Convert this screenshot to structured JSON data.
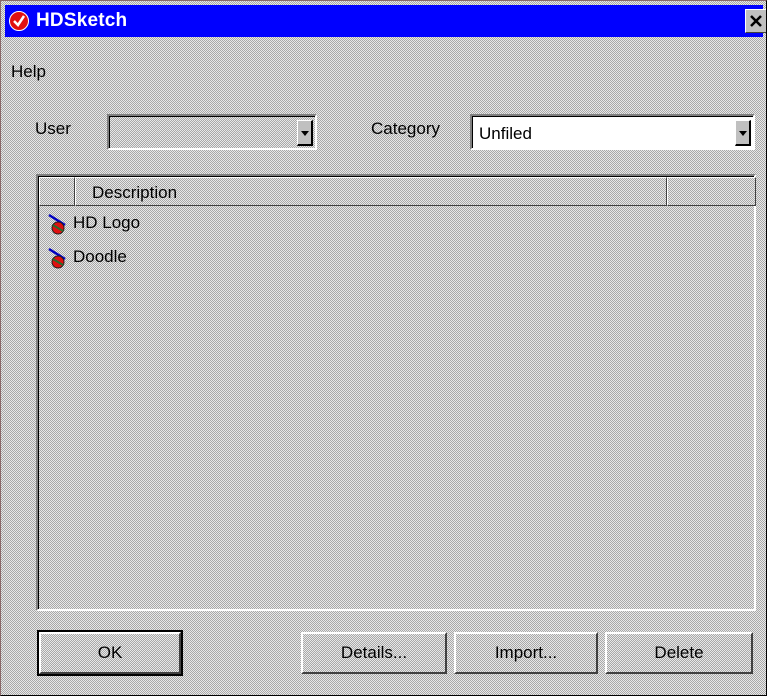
{
  "window": {
    "title": "HDSketch",
    "icon": "hdsketch-app-icon",
    "close_label": "×"
  },
  "menu": {
    "items": [
      "Help"
    ]
  },
  "filters": {
    "user_label": "User",
    "user_value": "",
    "category_label": "Category",
    "category_value": "Unfiled"
  },
  "list": {
    "columns": [
      "",
      "Description",
      ""
    ],
    "items": [
      {
        "label": "HD Logo",
        "icon": "sketch-icon"
      },
      {
        "label": "Doodle",
        "icon": "sketch-icon"
      }
    ]
  },
  "buttons": {
    "ok": "OK",
    "details": "Details...",
    "import": "Import...",
    "delete": "Delete"
  },
  "colors": {
    "titlebar": "#0000ff",
    "face": "#c0c0c0",
    "icon_red": "#e01010"
  }
}
